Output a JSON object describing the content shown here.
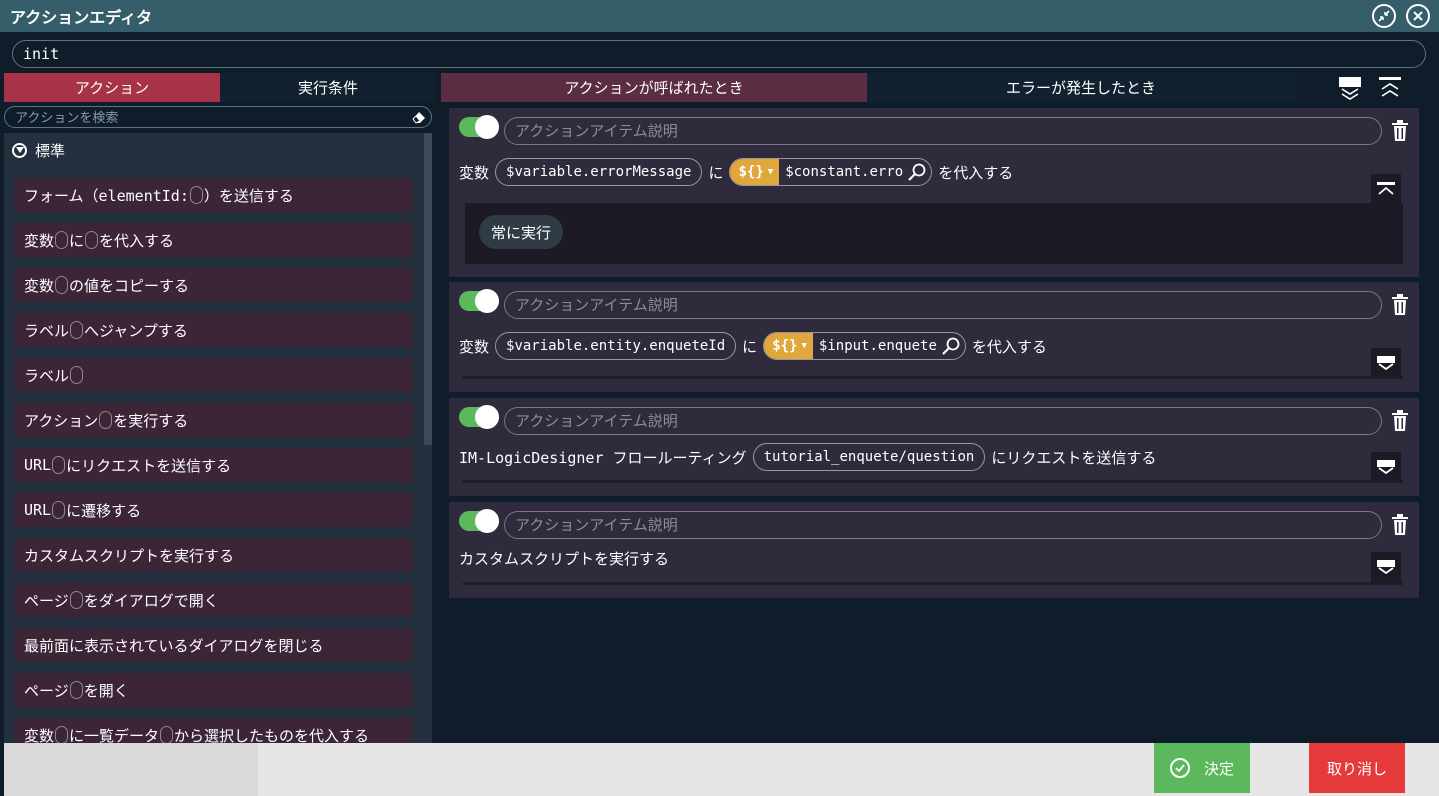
{
  "window": {
    "title": "アクションエディタ",
    "restore_icon": "restore-icon",
    "close_icon": "close-circle-icon"
  },
  "action_name": {
    "value": "init"
  },
  "left_tabs": [
    {
      "label": "アクション",
      "active": true
    },
    {
      "label": "実行条件",
      "active": false
    }
  ],
  "search": {
    "placeholder": "アクションを検索"
  },
  "group": {
    "label": "標準",
    "icon": "circle-chevron-down-icon"
  },
  "actions": [
    {
      "parts": [
        "フォーム（elementId:",
        "ph",
        "）を送信する"
      ]
    },
    {
      "parts": [
        "変数",
        "ph",
        "に",
        "ph",
        "を代入する"
      ]
    },
    {
      "parts": [
        "変数",
        "ph",
        "の値をコピーする"
      ]
    },
    {
      "parts": [
        "ラベル",
        "ph",
        "へジャンプする"
      ]
    },
    {
      "parts": [
        "ラベル",
        "ph"
      ]
    },
    {
      "parts": [
        "アクション",
        "ph",
        "を実行する"
      ]
    },
    {
      "parts": [
        "URL",
        "ph",
        "にリクエストを送信する"
      ]
    },
    {
      "parts": [
        "URL",
        "ph",
        "に遷移する"
      ]
    },
    {
      "parts": [
        "カスタムスクリプトを実行する"
      ]
    },
    {
      "parts": [
        "ページ",
        "ph",
        "をダイアログで開く"
      ]
    },
    {
      "parts": [
        "最前面に表示されているダイアログを閉じる"
      ]
    },
    {
      "parts": [
        "ページ",
        "ph",
        "を開く"
      ]
    },
    {
      "parts": [
        "変数",
        "ph",
        "に一覧データ",
        "ph",
        "から選択したものを代入する"
      ]
    }
  ],
  "right_tabs": [
    {
      "label": "アクションが呼ばれたとき",
      "active": true
    },
    {
      "label": "エラーが発生したとき",
      "active": false
    }
  ],
  "description_placeholder": "アクションアイテム説明",
  "cards": [
    {
      "enabled": true,
      "line": {
        "prefix": "変数",
        "variable": "$variable.errorMessage",
        "mid": "に",
        "type_label": "${}",
        "value": "$constant.erro",
        "suffix": "を代入する"
      },
      "condition": "常に実行"
    },
    {
      "enabled": true,
      "line": {
        "prefix": "変数",
        "variable": "$variable.entity.enqueteId",
        "mid": "に",
        "type_label": "${}",
        "value": "$input.enquete",
        "suffix": "を代入する"
      }
    },
    {
      "enabled": true,
      "line": {
        "prefix": "IM-LogicDesigner フロールーティング",
        "route": "tutorial_enquete/question",
        "suffix": "にリクエストを送信する"
      }
    },
    {
      "enabled": true,
      "line": {
        "text": "カスタムスクリプトを実行する"
      }
    }
  ],
  "footer": {
    "ok_label": "決定",
    "cancel_label": "取り消し"
  },
  "colors": {
    "titlebar": "#355e6a",
    "active_tab": "#a83246",
    "card_bg": "#2f2a3c",
    "toggle_on": "#5cb85c",
    "type_badge": "#e0a73c",
    "ok": "#5cb85c",
    "cancel": "#e5393c"
  }
}
